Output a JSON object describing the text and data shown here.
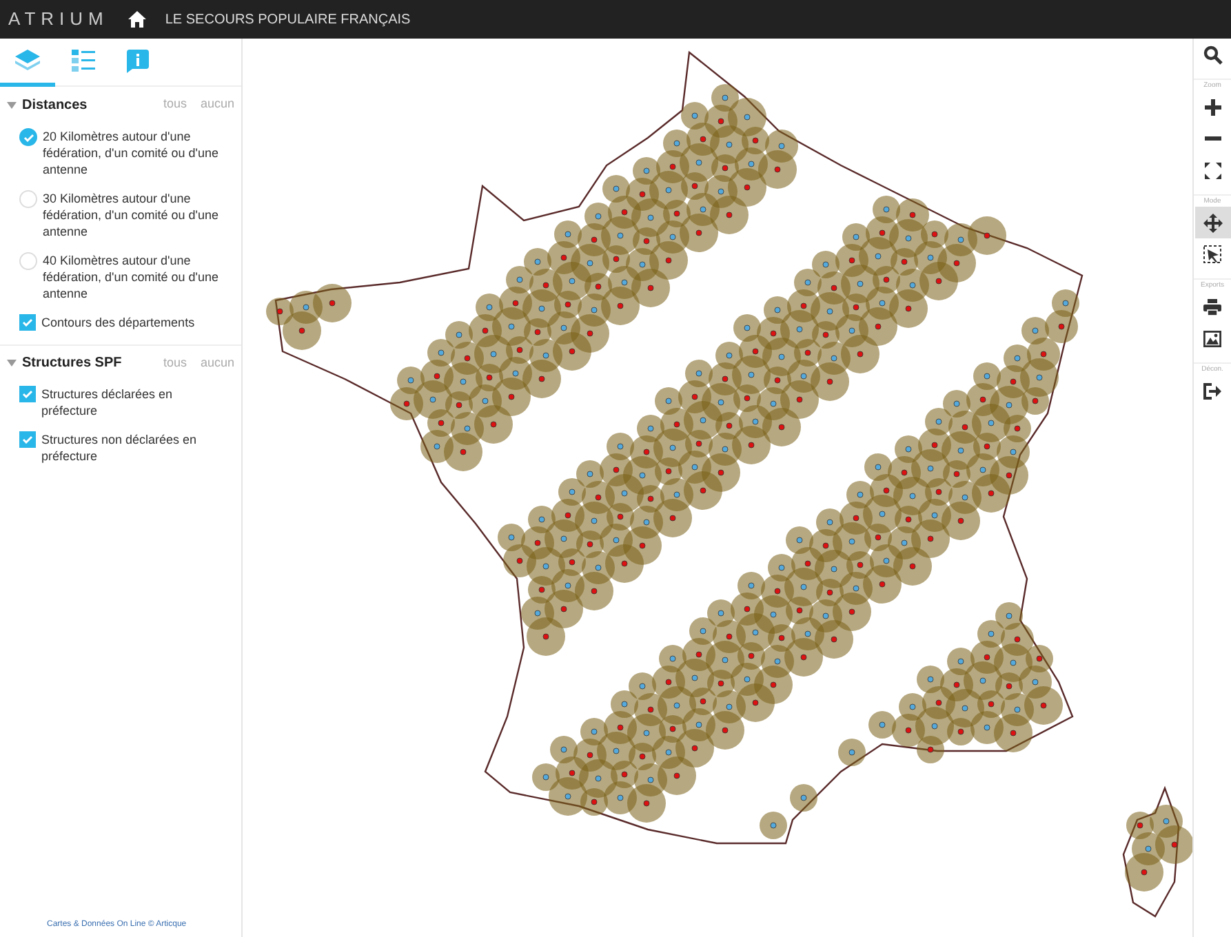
{
  "header": {
    "app_name": "ATRIUM",
    "title": "LE SECOURS POPULAIRE FRANÇAIS"
  },
  "sidebar": {
    "tabs": [
      {
        "kind": "layers",
        "selected": true
      },
      {
        "kind": "legend",
        "selected": false
      },
      {
        "kind": "info",
        "selected": false
      }
    ],
    "groups": [
      {
        "title": "Distances",
        "expanded": true,
        "select_all": "tous",
        "select_none": "aucun",
        "items": [
          {
            "kind": "radio",
            "label": "20 Kilomètres autour d'une fédération, d'un comité ou d'une antenne",
            "checked": true
          },
          {
            "kind": "radio",
            "label": "30 Kilomètres autour d'une fédération, d'un comité ou d'une antenne",
            "checked": false
          },
          {
            "kind": "radio",
            "label": "40 Kilomètres autour d'une fédération, d'un comité ou d'une antenne",
            "checked": false
          },
          {
            "kind": "checkbox",
            "label": "Contours des départements",
            "checked": true
          }
        ]
      },
      {
        "title": "Structures SPF",
        "expanded": true,
        "select_all": "tous",
        "select_none": "aucun",
        "items": [
          {
            "kind": "checkbox",
            "label": "Structures déclarées en préfecture",
            "checked": true
          },
          {
            "kind": "checkbox",
            "label": "Structures non déclarées en préfecture",
            "checked": true
          }
        ]
      }
    ],
    "credit": "Cartes & Données On Line © Articque"
  },
  "toolbar": {
    "sections": [
      {
        "tools": [
          {
            "kind": "search",
            "selected": false
          }
        ]
      },
      {
        "label": "Zoom",
        "tools": [
          {
            "kind": "zoom-in",
            "selected": false
          },
          {
            "kind": "zoom-out",
            "selected": false
          },
          {
            "kind": "fit",
            "selected": false
          }
        ]
      },
      {
        "label": "Mode",
        "tools": [
          {
            "kind": "pan",
            "selected": true
          },
          {
            "kind": "select",
            "selected": false
          }
        ]
      },
      {
        "label": "Exports",
        "tools": [
          {
            "kind": "print",
            "selected": false
          },
          {
            "kind": "image",
            "selected": false
          }
        ]
      },
      {
        "label": "Décon.",
        "tools": [
          {
            "kind": "logout",
            "selected": false
          }
        ]
      }
    ]
  }
}
